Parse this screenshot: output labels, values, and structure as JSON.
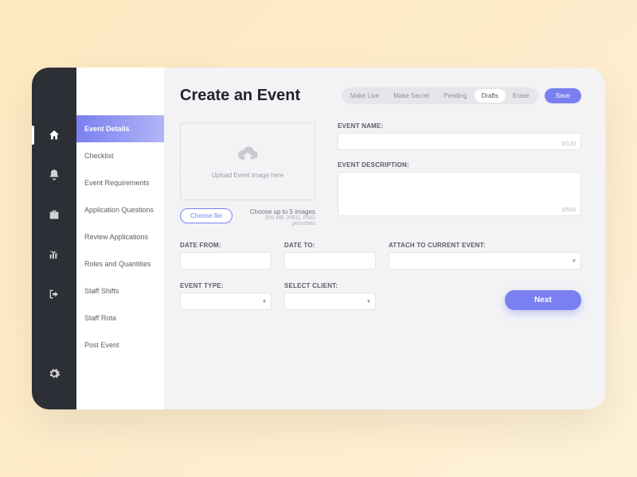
{
  "header": {
    "title": "Create an Event",
    "actions": [
      "Make Live",
      "Make Secret",
      "Pending",
      "Drafts",
      "Erase"
    ],
    "active_action": "Drafts",
    "save": "Save"
  },
  "sub_nav": {
    "items": [
      "Event Details",
      "Checklist",
      "Event Requirements",
      "Application Questions",
      "Review Applications",
      "Roles and Quantities",
      "Staff Shifts",
      "Staff Rota",
      "Post Event"
    ],
    "active": "Event Details"
  },
  "upload": {
    "placeholder": "Upload Event image here",
    "choose": "Choose file",
    "info_line1": "Choose up to 5 images",
    "info_line2": "200 MB JPEG, PNG permitted"
  },
  "fields": {
    "event_name_label": "EVENT NAME:",
    "event_name_counter": "0/120",
    "event_desc_label": "EVENT DESCRIPTION:",
    "event_desc_counter": "0/500",
    "date_from_label": "DATE FROM:",
    "date_to_label": "DATE TO:",
    "event_type_label": "EVENT TYPE:",
    "select_client_label": "SELECT CLIENT:",
    "attach_label": "ATTACH TO CURRENT EVENT:"
  },
  "buttons": {
    "next": "Next"
  },
  "icons": {
    "rail": [
      "home",
      "bell",
      "briefcase",
      "chart",
      "logout",
      "gear"
    ]
  }
}
